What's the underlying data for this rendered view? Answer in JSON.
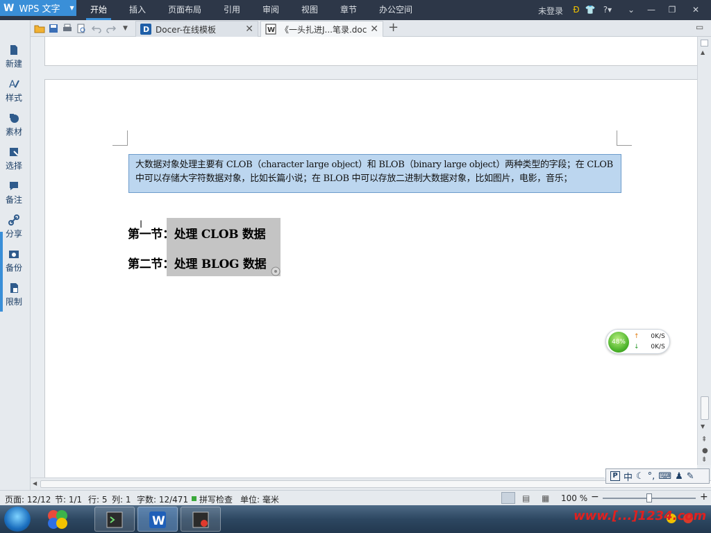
{
  "app": {
    "name": "WPS 文字"
  },
  "menu": {
    "tabs": [
      "开始",
      "插入",
      "页面布局",
      "引用",
      "审阅",
      "视图",
      "章节",
      "办公空间"
    ],
    "login": "未登录"
  },
  "doc_tabs": [
    {
      "label": "Docer-在线模板"
    },
    {
      "label": "《一头扎进J...笔录.doc"
    }
  ],
  "sidebar": {
    "items": [
      {
        "label": "新建",
        "icon": "new-doc-icon"
      },
      {
        "label": "样式",
        "icon": "style-icon"
      },
      {
        "label": "素材",
        "icon": "material-icon"
      },
      {
        "label": "选择",
        "icon": "select-icon"
      },
      {
        "label": "备注",
        "icon": "comment-icon"
      },
      {
        "label": "分享",
        "icon": "share-icon"
      },
      {
        "label": "备份",
        "icon": "backup-icon"
      },
      {
        "label": "限制",
        "icon": "restrict-icon"
      }
    ]
  },
  "document": {
    "info_line1": "大数据对象处理主要有 CLOB（character large object）和 BLOB（binary large object）两种类型的字段；在 CLOB",
    "info_line2": "中可以存储大字符数据对象，比如长篇小说；在 BLOB 中可以存放二进制大数据对象，比如图片，电影，音乐；",
    "heading1": "第一节：处理 CLOB 数据",
    "heading2": "第二节：处理 BLOG 数据"
  },
  "speed_widget": {
    "percent": "48%",
    "up": "0K/S",
    "down": "0K/S"
  },
  "ime_bar": {
    "items": [
      "中"
    ]
  },
  "status": {
    "page": "页面: 12/12",
    "section": "节: 1/1",
    "row": "行: 5",
    "col": "列: 1",
    "wordcount": "字数: 12/471",
    "spellcheck": "拼写检查",
    "unit": "单位: 毫米",
    "zoom": "100 %"
  },
  "taskbar": {
    "watermark": "www.[...]1234.com"
  },
  "colors": {
    "accent": "#3a8fd8",
    "menubar": "#2d3748",
    "info_box": "#bcd6ef"
  }
}
